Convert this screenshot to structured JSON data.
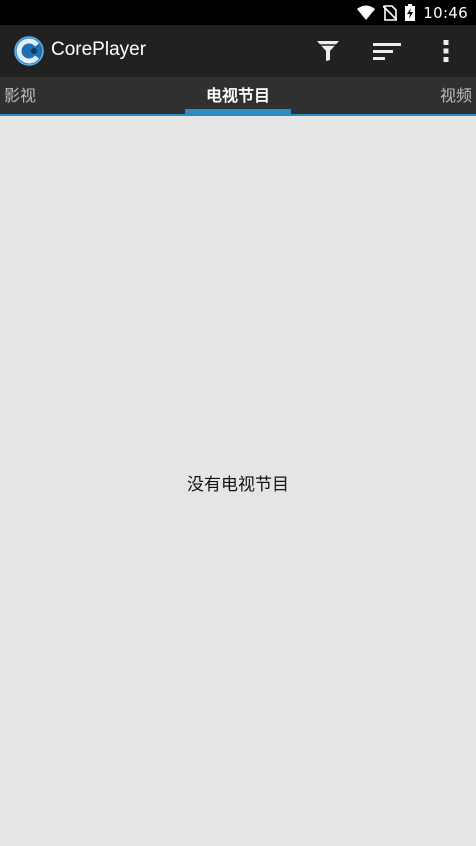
{
  "status_bar": {
    "time": "10:46",
    "icons": [
      "wifi-icon",
      "no-sim-icon",
      "battery-charging-icon"
    ]
  },
  "app_bar": {
    "title": "CorePlayer",
    "logo": "coreplayer-logo",
    "actions": [
      "filter-icon",
      "sort-icon",
      "more-vert-icon"
    ]
  },
  "tabs": {
    "items": [
      {
        "label": "影视",
        "selected": false
      },
      {
        "label": "电视节目",
        "selected": true
      },
      {
        "label": "视频",
        "selected": false
      }
    ]
  },
  "content": {
    "empty_message": "没有电视节目"
  },
  "colors": {
    "status_bar": "#000000",
    "app_bar": "#212121",
    "tab_bar": "#303030",
    "accent": "#2e8bc0",
    "background": "#e5e5e5"
  }
}
